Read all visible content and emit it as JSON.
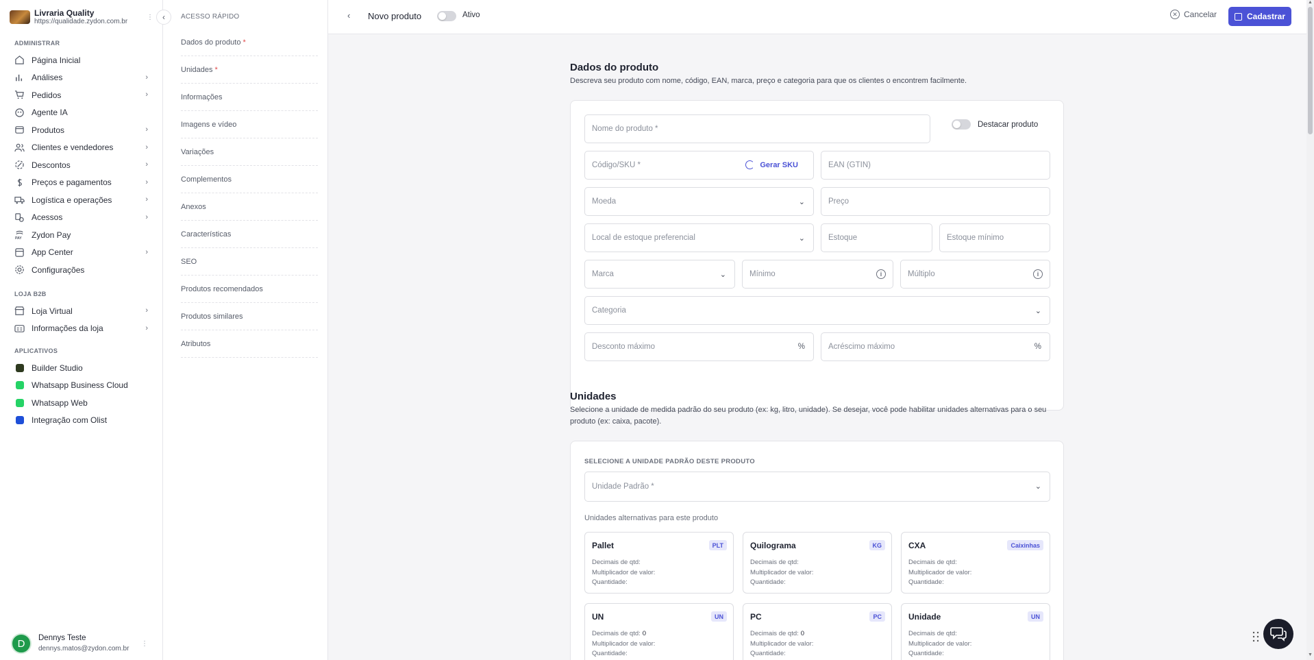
{
  "brand": {
    "name": "Livraria Quality",
    "url": "https://qualidade.zydon.com.br"
  },
  "sidebar": {
    "section_admin": "ADMINISTRAR",
    "admin_items": [
      {
        "label": "Página Inicial",
        "icon": "home-icon",
        "has_chevron": false
      },
      {
        "label": "Análises",
        "icon": "bar-chart-icon",
        "has_chevron": true
      },
      {
        "label": "Pedidos",
        "icon": "cart-icon",
        "has_chevron": true
      },
      {
        "label": "Agente IA",
        "icon": "ai-agent-icon",
        "has_chevron": false
      },
      {
        "label": "Produtos",
        "icon": "box-icon",
        "has_chevron": true
      },
      {
        "label": "Clientes e vendedores",
        "icon": "users-icon",
        "has_chevron": true
      },
      {
        "label": "Descontos",
        "icon": "discount-icon",
        "has_chevron": true
      },
      {
        "label": "Preços e pagamentos",
        "icon": "dollar-icon",
        "has_chevron": true
      },
      {
        "label": "Logística e operações",
        "icon": "truck-icon",
        "has_chevron": true
      },
      {
        "label": "Acessos",
        "icon": "access-icon",
        "has_chevron": true
      },
      {
        "label": "Zydon Pay",
        "icon": "pay-icon",
        "has_chevron": false
      },
      {
        "label": "App Center",
        "icon": "app-center-icon",
        "has_chevron": true
      },
      {
        "label": "Configurações",
        "icon": "gear-icon",
        "has_chevron": false
      }
    ],
    "section_b2b": "LOJA B2B",
    "b2b_items": [
      {
        "label": "Loja Virtual",
        "icon": "store-icon",
        "has_chevron": true
      },
      {
        "label": "Informações da loja",
        "icon": "store-info-icon",
        "has_chevron": true
      }
    ],
    "section_apps": "APLICATIVOS",
    "app_items": [
      {
        "label": "Builder Studio",
        "icon": "builder-studio-icon",
        "color": "#2e3a1f"
      },
      {
        "label": "Whatsapp Business Cloud",
        "icon": "whatsapp-icon",
        "color": "#25d366"
      },
      {
        "label": "Whatsapp Web",
        "icon": "whatsapp-icon",
        "color": "#25d366"
      },
      {
        "label": "Integração com Olist",
        "icon": "olist-icon",
        "color": "#1e4fd8"
      }
    ]
  },
  "user": {
    "initial": "D",
    "name": "Dennys Teste",
    "email": "dennys.matos@zydon.com.br"
  },
  "quick_access": {
    "title": "ACESSO RÁPIDO",
    "items": [
      {
        "label": "Dados do produto",
        "required": "*"
      },
      {
        "label": "Unidades",
        "required": "*"
      },
      {
        "label": "Informações",
        "required": ""
      },
      {
        "label": "Imagens e vídeo",
        "required": ""
      },
      {
        "label": "Variações",
        "required": ""
      },
      {
        "label": "Complementos",
        "required": ""
      },
      {
        "label": "Anexos",
        "required": ""
      },
      {
        "label": "Características",
        "required": ""
      },
      {
        "label": "SEO",
        "required": ""
      },
      {
        "label": "Produtos recomendados",
        "required": ""
      },
      {
        "label": "Produtos similares",
        "required": ""
      },
      {
        "label": "Atributos",
        "required": ""
      }
    ]
  },
  "topbar": {
    "title": "Novo produto",
    "active_label": "Ativo",
    "cancel": "Cancelar",
    "save": "Cadastrar",
    "accent": "#4b52d6"
  },
  "product": {
    "heading": "Dados do produto",
    "description": "Descreva seu produto com nome, código, EAN, marca, preço e categoria para que os clientes o encontrem facilmente.",
    "name_placeholder": "Nome do produto *",
    "highlight_label": "Destacar produto",
    "sku_placeholder": "Código/SKU *",
    "gen_sku": "Gerar SKU",
    "ean_placeholder": "EAN (GTIN)",
    "currency_placeholder": "Moeda",
    "price_placeholder": "Preço",
    "stock_location_placeholder": "Local de estoque preferencial",
    "stock_placeholder": "Estoque",
    "min_stock_placeholder": "Estoque mínimo",
    "brand_placeholder": "Marca",
    "minimum_placeholder": "Mínimo",
    "multiple_placeholder": "Múltiplo",
    "category_placeholder": "Categoria",
    "max_discount_placeholder": "Desconto máximo",
    "max_increase_placeholder": "Acréscimo máximo",
    "percent": "%"
  },
  "units": {
    "heading": "Unidades",
    "description": "Selecione a unidade de medida padrão do seu produto (ex: kg, litro, unidade). Se desejar, você pode habilitar unidades alternativas para o seu produto (ex: caixa, pacote).",
    "select_label": "SELECIONE A UNIDADE PADRÃO DESTE PRODUTO",
    "default_placeholder": "Unidade Padrão *",
    "alt_label": "Unidades alternativas para este produto",
    "row_labels": {
      "decimals": "Decimais de qtd:",
      "multiplier": "Multiplicador de valor:",
      "quantity": "Quantidade:"
    },
    "cards": [
      {
        "name": "Pallet",
        "badge": "PLT",
        "decimals": "",
        "multiplier": "",
        "quantity": ""
      },
      {
        "name": "Quilograma",
        "badge": "KG",
        "decimals": "",
        "multiplier": "",
        "quantity": ""
      },
      {
        "name": "CXA",
        "badge": "Caixinhas",
        "decimals": "",
        "multiplier": "",
        "quantity": ""
      },
      {
        "name": "UN",
        "badge": "UN",
        "decimals": "0",
        "multiplier": "",
        "quantity": ""
      },
      {
        "name": "PC",
        "badge": "PC",
        "decimals": "0",
        "multiplier": "",
        "quantity": ""
      },
      {
        "name": "Unidade",
        "badge": "UN",
        "decimals": "",
        "multiplier": "",
        "quantity": ""
      }
    ]
  }
}
